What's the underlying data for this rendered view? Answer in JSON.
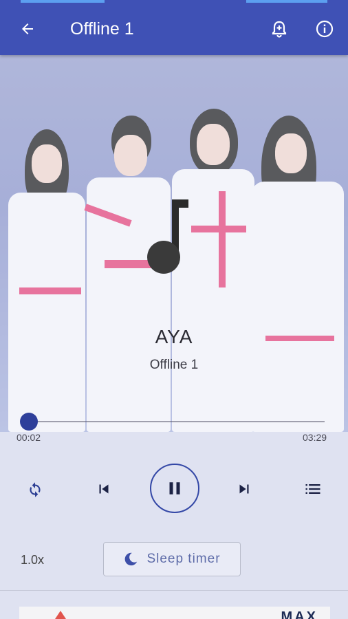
{
  "appbar": {
    "title": "Offline 1",
    "accent_color": "#3f51b5",
    "icons": [
      "back-arrow-icon",
      "alarm-add-icon",
      "info-icon"
    ]
  },
  "track": {
    "title": "AYA",
    "subtitle": "Offline 1",
    "artwork_icon": "music-note-icon"
  },
  "progress": {
    "current": "00:02",
    "total": "03:29",
    "fraction": 0.01
  },
  "controls": {
    "icons": [
      "repeat-icon",
      "skip-previous-icon",
      "pause-icon",
      "skip-next-icon",
      "queue-list-icon"
    ]
  },
  "extras": {
    "speed": "1.0x",
    "sleep_timer_label": "Sleep timer",
    "sleep_icon": "moon-icon"
  },
  "ad": {
    "text": "MAX"
  }
}
